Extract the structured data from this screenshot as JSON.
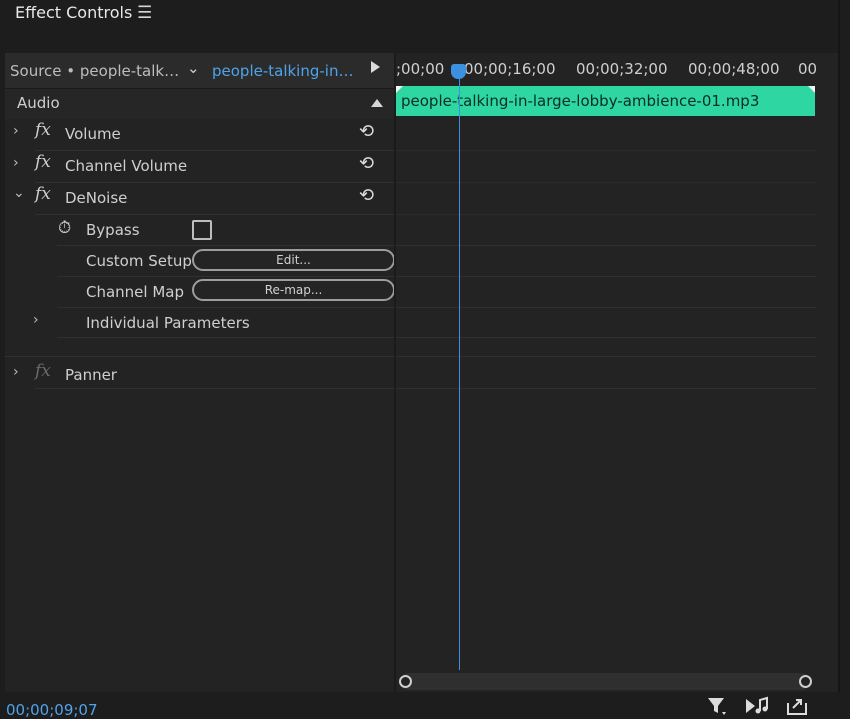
{
  "panel": {
    "title": "Effect Controls",
    "menu_icon": "hamburger-icon"
  },
  "source": {
    "label": "Source • people-talk…",
    "dropdown_icon": "chevron-down-icon",
    "clip_link": "people-talking-in…",
    "play_icon": "play-icon"
  },
  "sections": {
    "audio": "Audio"
  },
  "effects": [
    {
      "name": "Volume",
      "expanded": false
    },
    {
      "name": "Channel Volume",
      "expanded": false
    },
    {
      "name": "DeNoise",
      "expanded": true
    },
    {
      "name": "Panner",
      "expanded": false
    }
  ],
  "denoise": {
    "bypass_label": "Bypass",
    "bypass_checked": false,
    "custom_setup_label": "Custom Setup",
    "edit_button": "Edit...",
    "channel_map_label": "Channel Map",
    "remap_button": "Re-map...",
    "individual_parameters_label": "Individual Parameters"
  },
  "icons": {
    "fx": "fx",
    "chevron_right": "›",
    "chevron_down": "⌄",
    "reset": "⟲",
    "stopwatch": "⏱"
  },
  "timeline": {
    "ticks": [
      ";00;00",
      "00;00;16;00",
      "00;00;32;00",
      "00;00;48;00",
      "00"
    ],
    "clip_name": "people-talking-in-large-lobby-ambience-01.mp3",
    "clip_color": "#2ed6a2",
    "playhead_color": "#3d8fe0"
  },
  "footer": {
    "timecode": "00;00;09;07",
    "filter_icon": "filter-icon",
    "play_audio_icon": "play-audio-icon",
    "export_icon": "export-icon"
  }
}
